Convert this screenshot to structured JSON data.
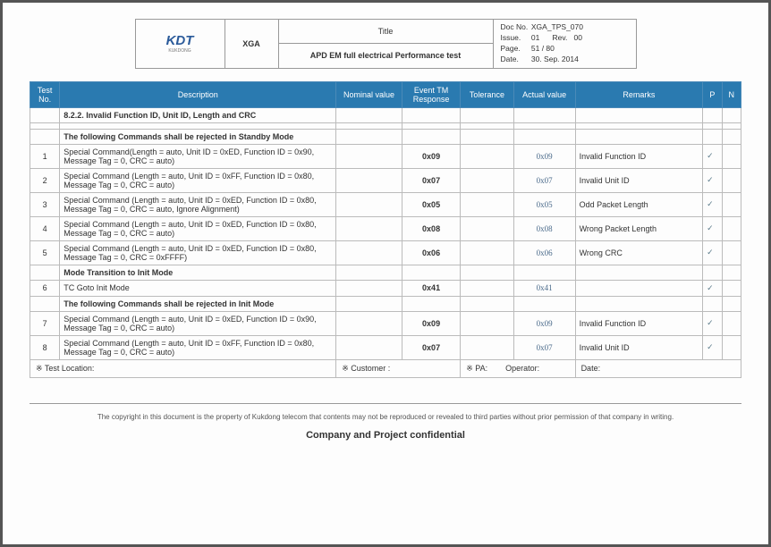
{
  "header": {
    "logo": "KDT",
    "logo_sub": "KUKDONG",
    "code": "XGA",
    "title_label": "Title",
    "title_main": "APD EM full electrical Performance test",
    "doc_no_label": "Doc No.",
    "doc_no": "XGA_TPS_070",
    "issue_label": "Issue.",
    "issue": "01",
    "rev_label": "Rev.",
    "rev": "00",
    "page_label": "Page.",
    "page": "51 / 80",
    "date_label": "Date.",
    "date": "30. Sep. 2014"
  },
  "columns": {
    "testno": "Test No.",
    "desc": "Description",
    "nom": "Nominal value",
    "evt": "Event TM Response",
    "tol": "Tolerance",
    "act": "Actual value",
    "rem": "Remarks",
    "p": "P",
    "n": "N"
  },
  "section_top": "8.2.2. Invalid Function ID, Unit ID, Length and CRC",
  "section_standby": "The following Commands shall be rejected in Standby Mode",
  "section_mode": "Mode Transition to Init Mode",
  "section_init": "The following Commands shall be rejected in Init Mode",
  "rows": [
    {
      "no": "1",
      "desc": "Special Command(Length = auto, Unit ID = 0xED, Function ID = 0x90, Message Tag = 0, CRC = auto)",
      "evt": "0x09",
      "act": "0x09",
      "rem": "Invalid Function ID",
      "p": "✓"
    },
    {
      "no": "2",
      "desc": "Special Command (Length = auto, Unit ID = 0xFF, Function ID = 0x80, Message Tag = 0, CRC = auto)",
      "evt": "0x07",
      "act": "0x07",
      "rem": "Invalid Unit ID",
      "p": "✓"
    },
    {
      "no": "3",
      "desc": "Special Command (Length = auto, Unit ID = 0xED, Function ID = 0x80, Message Tag = 0, CRC = auto, Ignore Alignment)",
      "evt": "0x05",
      "act": "0x05",
      "rem": "Odd Packet Length",
      "p": "✓"
    },
    {
      "no": "4",
      "desc": "Special Command (Length = auto, Unit ID = 0xED, Function ID = 0x80, Message Tag = 0, CRC = auto)",
      "evt": "0x08",
      "act": "0x08",
      "rem": "Wrong Packet Length",
      "p": "✓"
    },
    {
      "no": "5",
      "desc": "Special Command (Length = auto, Unit ID = 0xED, Function ID = 0x80, Message Tag = 0, CRC = 0xFFFF)",
      "evt": "0x06",
      "act": "0x06",
      "rem": "Wrong CRC",
      "p": "✓"
    },
    {
      "no": "6",
      "desc": "TC Goto Init Mode",
      "evt": "0x41",
      "act": "0x41",
      "rem": "",
      "p": "✓"
    },
    {
      "no": "7",
      "desc": "Special Command (Length = auto, Unit ID = 0xED, Function ID = 0x90, Message Tag = 0, CRC = auto)",
      "evt": "0x09",
      "act": "0x09",
      "rem": "Invalid Function ID",
      "p": "✓"
    },
    {
      "no": "8",
      "desc": "Special Command (Length = auto, Unit ID = 0xFF, Function ID = 0x80, Message Tag = 0, CRC = auto)",
      "evt": "0x07",
      "act": "0x07",
      "rem": "Invalid Unit ID",
      "p": "✓"
    }
  ],
  "footer": {
    "test_location": "Test Location:",
    "customer": "Customer :",
    "pa": "PA:",
    "operator": "Operator:",
    "date": "Date:"
  },
  "copyright": "The copyright in this document is the property of Kukdong telecom that contents may not be reproduced or revealed to third parties without prior permission of that company in writing.",
  "confidential": "Company and Project confidential"
}
